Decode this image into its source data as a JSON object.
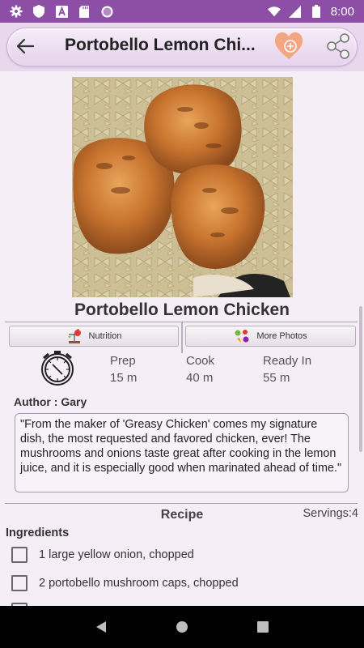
{
  "status_bar": {
    "time": "8:00",
    "left_icons": [
      "gear-icon",
      "shield-icon",
      "text-a-icon",
      "sd-card-icon",
      "circle-dots-icon"
    ],
    "right_icons": [
      "wifi-icon",
      "signal-icon",
      "battery-icon"
    ],
    "background": "#8d4fa6"
  },
  "app_bar": {
    "title": "Portobello Lemon Chi...",
    "back_icon": "arrow-left-icon",
    "favorite_icon": "heart-plus-icon",
    "share_icon": "share-icon",
    "accent": "#f4a582"
  },
  "recipe": {
    "photo": "roasted-chicken-with-bowtie-pasta",
    "title": "Portobello Lemon Chicken",
    "tabs": {
      "nutrition": {
        "label": "Nutrition",
        "icon": "scale-apple-icon"
      },
      "photos": {
        "label": "More Photos",
        "icon": "vegetables-icon"
      }
    },
    "times": {
      "icon": "stopwatch-icon",
      "prep": {
        "label": "Prep",
        "value": "15 m"
      },
      "cook": {
        "label": "Cook",
        "value": "40 m"
      },
      "ready": {
        "label": "Ready In",
        "value": "55 m"
      }
    },
    "author": "Author : Gary",
    "description": "\"From the maker of 'Greasy Chicken' comes my signature dish, the most requested and favored chicken, ever! The mushrooms and onions taste great after cooking in the lemon juice, and it is especially good when marinated ahead of time.\"",
    "recipe_heading": "Recipe",
    "servings": "Servings:4",
    "ingredients_heading": "Ingredients",
    "ingredients": [
      "1 large yellow onion, chopped",
      "2 portobello mushroom caps, chopped"
    ]
  },
  "nav_bar": {
    "back_icon": "triangle-back-icon",
    "home_icon": "circle-home-icon",
    "recents_icon": "square-recents-icon"
  }
}
